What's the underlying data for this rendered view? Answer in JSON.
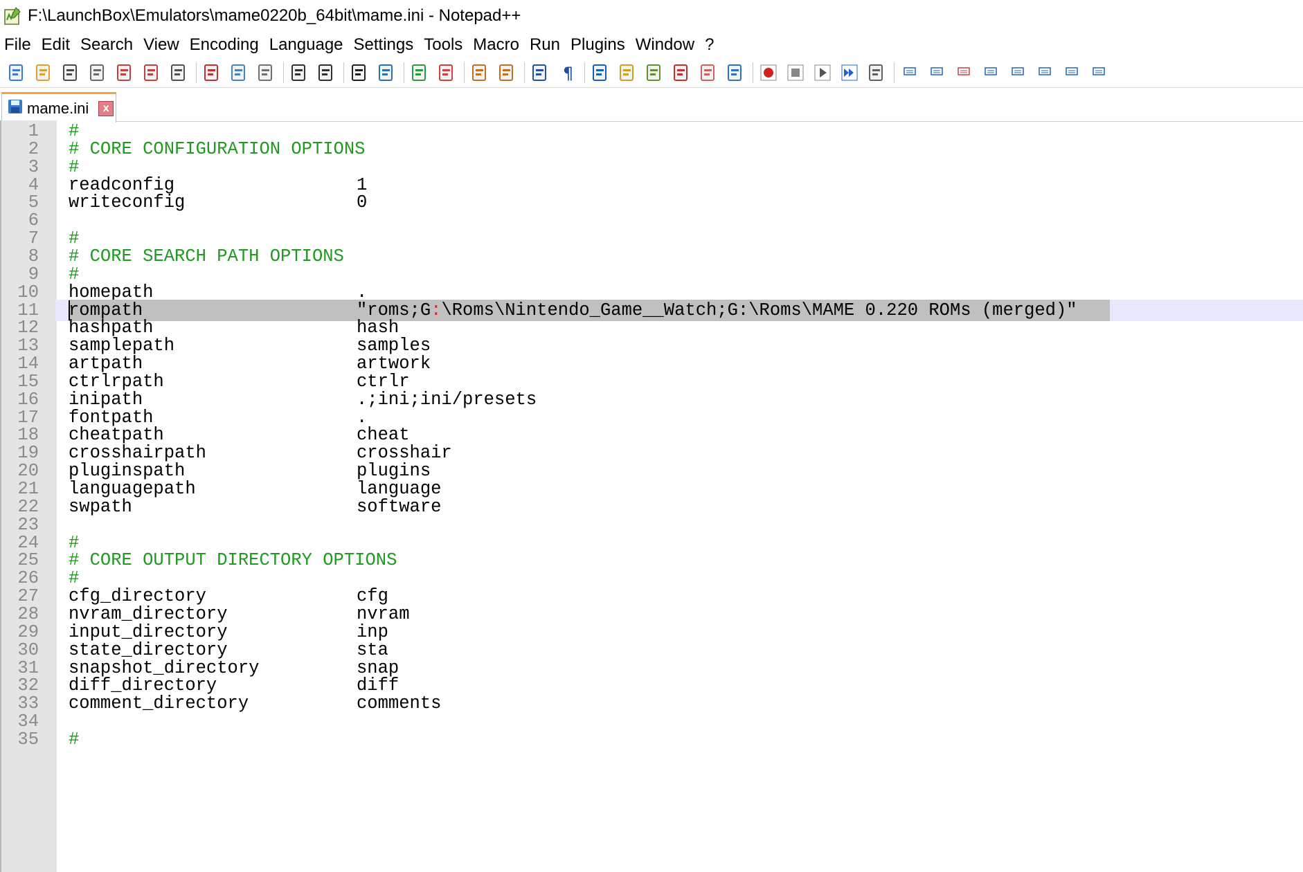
{
  "window": {
    "title": "F:\\LaunchBox\\Emulators\\mame0220b_64bit\\mame.ini - Notepad++"
  },
  "menu": [
    "File",
    "Edit",
    "Search",
    "View",
    "Encoding",
    "Language",
    "Settings",
    "Tools",
    "Macro",
    "Run",
    "Plugins",
    "Window",
    "?"
  ],
  "toolbar": {
    "buttons": [
      "new-file-icon",
      "open-file-icon",
      "save-icon",
      "save-all-icon",
      "close-icon",
      "close-all-icon",
      "print-icon",
      "cut-icon",
      "copy-icon",
      "paste-icon",
      "undo-icon",
      "redo-icon",
      "find-icon",
      "replace-icon",
      "zoom-in-icon",
      "zoom-out-icon",
      "sync-vertical-icon",
      "sync-horizontal-icon",
      "word-wrap-icon",
      "show-all-chars-icon",
      "indent-guide-icon",
      "document-map-icon",
      "function-list-icon",
      "lang-udl-icon",
      "folder-workspace-icon",
      "monitoring-icon",
      "record-macro-icon",
      "stop-macro-icon",
      "play-macro-icon",
      "run-multiple-macro-icon",
      "save-macro-icon",
      "plugin-1-icon",
      "plugin-2-icon",
      "plugin-3-icon",
      "plugin-4-icon",
      "plugin-up-icon",
      "plugin-down-icon",
      "plugin-7-icon",
      "plugin-8-icon"
    ]
  },
  "tab": {
    "label": "mame.ini",
    "close": "x"
  },
  "editor": {
    "current_line": 11,
    "lines": [
      {
        "n": "1",
        "type": "comment",
        "text": "#"
      },
      {
        "n": "2",
        "type": "comment",
        "text": "# CORE CONFIGURATION OPTIONS"
      },
      {
        "n": "3",
        "type": "comment",
        "text": "#"
      },
      {
        "n": "4",
        "type": "kv",
        "key": "readconfig",
        "value": "1"
      },
      {
        "n": "5",
        "type": "kv",
        "key": "writeconfig",
        "value": "0"
      },
      {
        "n": "6",
        "type": "blank"
      },
      {
        "n": "7",
        "type": "comment",
        "text": "#"
      },
      {
        "n": "8",
        "type": "comment",
        "text": "# CORE SEARCH PATH OPTIONS"
      },
      {
        "n": "9",
        "type": "comment",
        "text": "#"
      },
      {
        "n": "10",
        "type": "kv",
        "key": "homepath",
        "value": "."
      },
      {
        "n": "11",
        "type": "kv",
        "key": "rompath",
        "value_parts": [
          "\"roms;G",
          ":",
          "\\Roms\\Nintendo_Game__Watch;G:\\Roms\\MAME 0.220 ROMs (merged)\""
        ]
      },
      {
        "n": "12",
        "type": "kv",
        "key": "hashpath",
        "value": "hash"
      },
      {
        "n": "13",
        "type": "kv",
        "key": "samplepath",
        "value": "samples"
      },
      {
        "n": "14",
        "type": "kv",
        "key": "artpath",
        "value": "artwork"
      },
      {
        "n": "15",
        "type": "kv",
        "key": "ctrlrpath",
        "value": "ctrlr"
      },
      {
        "n": "16",
        "type": "kv",
        "key": "inipath",
        "value": ".;ini;ini/presets"
      },
      {
        "n": "17",
        "type": "kv",
        "key": "fontpath",
        "value": "."
      },
      {
        "n": "18",
        "type": "kv",
        "key": "cheatpath",
        "value": "cheat"
      },
      {
        "n": "19",
        "type": "kv",
        "key": "crosshairpath",
        "value": "crosshair"
      },
      {
        "n": "20",
        "type": "kv",
        "key": "pluginspath",
        "value": "plugins"
      },
      {
        "n": "21",
        "type": "kv",
        "key": "languagepath",
        "value": "language"
      },
      {
        "n": "22",
        "type": "kv",
        "key": "swpath",
        "value": "software"
      },
      {
        "n": "23",
        "type": "blank"
      },
      {
        "n": "24",
        "type": "comment",
        "text": "#"
      },
      {
        "n": "25",
        "type": "comment",
        "text": "# CORE OUTPUT DIRECTORY OPTIONS"
      },
      {
        "n": "26",
        "type": "comment",
        "text": "#"
      },
      {
        "n": "27",
        "type": "kv",
        "key": "cfg_directory",
        "value": "cfg"
      },
      {
        "n": "28",
        "type": "kv",
        "key": "nvram_directory",
        "value": "nvram"
      },
      {
        "n": "29",
        "type": "kv",
        "key": "input_directory",
        "value": "inp"
      },
      {
        "n": "30",
        "type": "kv",
        "key": "state_directory",
        "value": "sta"
      },
      {
        "n": "31",
        "type": "kv",
        "key": "snapshot_directory",
        "value": "snap"
      },
      {
        "n": "32",
        "type": "kv",
        "key": "diff_directory",
        "value": "diff"
      },
      {
        "n": "33",
        "type": "kv",
        "key": "comment_directory",
        "value": "comments"
      },
      {
        "n": "34",
        "type": "blank"
      },
      {
        "n": "35",
        "type": "comment",
        "text": "#"
      }
    ]
  },
  "colors": {
    "comment": "#1e9a1e",
    "line_number": "#8a8a8a",
    "gutter": "#e4e4e4",
    "current_line": "#e8e8ff",
    "selection": "#c0c0c0",
    "tab_accent": "#f9a13a",
    "operator": "#e02020"
  }
}
